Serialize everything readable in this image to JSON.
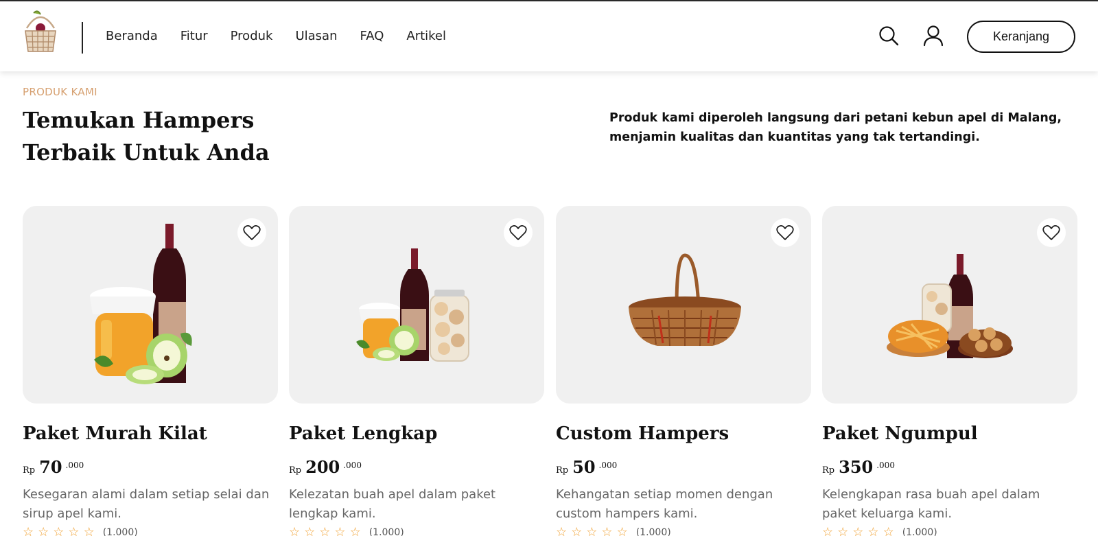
{
  "nav": {
    "items": [
      "Beranda",
      "Fitur",
      "Produk",
      "Ulasan",
      "FAQ",
      "Artikel"
    ],
    "cart_label": "Keranjang",
    "search_icon": "search-icon",
    "user_icon": "user-icon"
  },
  "hero": {
    "eyebrow": "PRODUK KAMI",
    "title_line1": "Temukan Hampers",
    "title_line2": "Terbaik Untuk Anda",
    "description": "Produk kami diperoleh langsung dari petani kebun apel di Malang, menjamin kualitas dan kuantitas yang tak tertandingi."
  },
  "products": [
    {
      "name": "Paket Murah Kilat",
      "currency": "Rp",
      "price": "70",
      "price_decimal": ".000",
      "description": "Kesegaran alami dalam setiap selai dan sirup apel kami.",
      "rating_count": "(1.000)"
    },
    {
      "name": "Paket Lengkap",
      "currency": "Rp",
      "price": "200",
      "price_decimal": ".000",
      "description": "Kelezatan buah apel dalam paket lengkap kami.",
      "rating_count": "(1.000)"
    },
    {
      "name": "Custom Hampers",
      "currency": "Rp",
      "price": "50",
      "price_decimal": ".000",
      "description": "Kehangatan setiap momen dengan custom hampers kami.",
      "rating_count": "(1.000)"
    },
    {
      "name": "Paket Ngumpul",
      "currency": "Rp",
      "price": "350",
      "price_decimal": ".000",
      "description": "Kelengkapan rasa buah apel dalam paket keluarga kami.",
      "rating_count": "(1.000)"
    }
  ],
  "colors": {
    "accent": "#d6a070",
    "star": "#f0a030",
    "card_bg": "#f0f0f0"
  }
}
